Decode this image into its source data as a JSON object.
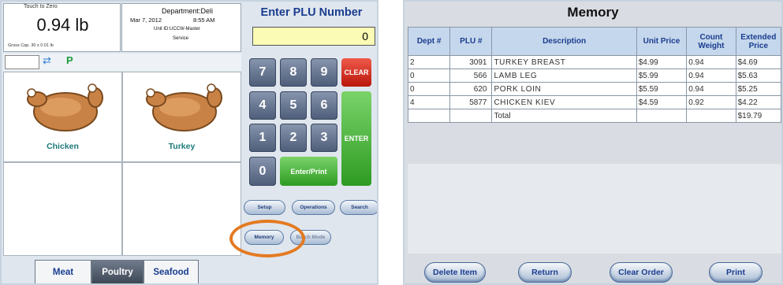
{
  "scale": {
    "touch_to_zero": "Touch to Zero",
    "weight": "0.94 lb",
    "gross_info": "Gross   Cap. 30 x 0.01 lb",
    "department": "Department:Deli",
    "date": "Mar 7, 2012",
    "time": "8:55 AM",
    "unit": "Unit ID:UCCW-Master",
    "mode": "Service"
  },
  "plu": {
    "title": "Enter PLU Number",
    "value": "0"
  },
  "products": [
    {
      "label": "Chicken"
    },
    {
      "label": "Turkey"
    }
  ],
  "keypad": {
    "keys": [
      "7",
      "8",
      "9",
      "4",
      "5",
      "6",
      "1",
      "2",
      "3",
      "0"
    ],
    "clear": "CLEAR",
    "enter": "ENTER",
    "enter_print": "Enter/Print"
  },
  "actions": {
    "setup": "Setup",
    "operations": "Operations",
    "search": "Search",
    "memory": "Memory",
    "batch_mode": "Batch Mode"
  },
  "tabs": [
    {
      "label": "Meat",
      "active": false
    },
    {
      "label": "Poultry",
      "active": true
    },
    {
      "label": "Seafood",
      "active": false
    }
  ],
  "memory": {
    "title": "Memory",
    "headers": {
      "dept": "Dept #",
      "plu": "PLU #",
      "description": "Description",
      "unit_price": "Unit Price",
      "count_weight": "Count Weight",
      "extended_price": "Extended Price"
    },
    "rows": [
      {
        "dept": "2",
        "plu": "3091",
        "description": "TURKEY BREAST",
        "unit_price": "$4.99",
        "count_weight": "0.94",
        "extended_price": "$4.69"
      },
      {
        "dept": "0",
        "plu": "566",
        "description": "LAMB LEG",
        "unit_price": "$5.99",
        "count_weight": "0.94",
        "extended_price": "$5.63"
      },
      {
        "dept": "0",
        "plu": "620",
        "description": "PORK LOIN",
        "unit_price": "$5.59",
        "count_weight": "0.94",
        "extended_price": "$5.25"
      },
      {
        "dept": "4",
        "plu": "5877",
        "description": "CHICKEN KIEV",
        "unit_price": "$4.59",
        "count_weight": "0.92",
        "extended_price": "$4.22"
      }
    ],
    "total_label": "Total",
    "total_value": "$19.79",
    "buttons": {
      "delete_item": "Delete Item",
      "return": "Return",
      "clear_order": "Clear Order",
      "print": "Print"
    }
  },
  "colors": {
    "accent_blue": "#1a3d8f",
    "highlight_ring": "#e47a21",
    "plu_field": "#fbfbb5",
    "clear_key": "#d02a1c",
    "enter_key": "#3faa30",
    "product_label": "#1e7a7a"
  }
}
